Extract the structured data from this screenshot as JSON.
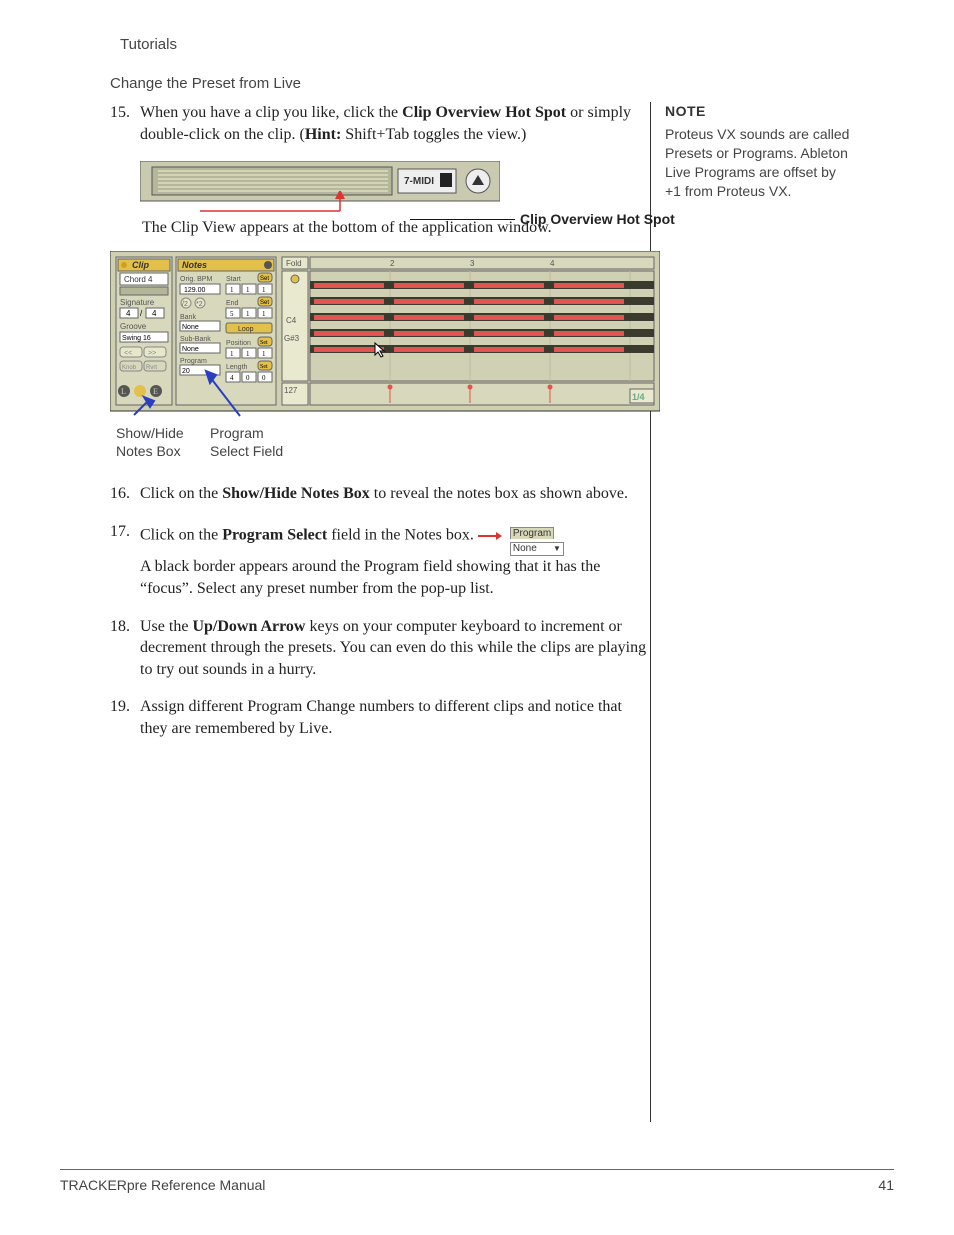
{
  "header": {
    "title": "Tutorials"
  },
  "subheading": "Change the Preset from Live",
  "note": {
    "heading": "NOTE",
    "body": "Proteus VX sounds are called Presets or Programs. Ableton Live Programs are offset by +1 from Proteus VX."
  },
  "steps": [
    {
      "num": "15.",
      "pre": "When you have a clip you like, click the ",
      "bold1": "Clip Overview Hot Spot",
      "mid": " or simply double-click on the clip. (",
      "hintLabel": "Hint:",
      "hintText": " Shift+Tab toggles the view.)"
    },
    {
      "num": "16.",
      "pre": "Click on the ",
      "bold1": "Show/Hide Notes Box",
      "post": " to reveal the notes box as shown above."
    },
    {
      "num": "17.",
      "pre": "Click on the ",
      "bold1": "Program Select",
      "mid": " field in the Notes box.",
      "after": "A black border appears around the Program field showing that it has the “focus”. Select any preset number from the pop-up list."
    },
    {
      "num": "18.",
      "pre": "Use the ",
      "bold1": "Up/Down Arrow",
      "post": " keys on your computer keyboard to increment or decrement through the presets. You can even do this while the clips are playing to try out sounds in a hurry."
    },
    {
      "num": "19.",
      "plain": "Assign different Program Change numbers to different clips and notice that they are remembered by Live."
    }
  ],
  "caption_intro": "The Clip View appears at the bottom of the application window.",
  "fig1": {
    "callout": "Clip Overview Hot Spot",
    "midi_label": "7-MIDI"
  },
  "fig2": {
    "labels": {
      "show_hide_l1": "Show/Hide",
      "show_hide_l2": "Notes Box",
      "program_l1": "Program",
      "program_l2": "Select Field"
    },
    "clip_panel": {
      "title": "Clip",
      "name": "Chord 4",
      "sig_label": "Signature",
      "sig_a": "4",
      "sig_sep": "/",
      "sig_b": "4",
      "groove_label": "Groove",
      "groove_val": "Swing 16",
      "btn_left": "<<",
      "btn_right": ">>",
      "bot_a": "Knob",
      "bot_b": "Rvrt"
    },
    "notes_panel": {
      "title": "Notes",
      "orig_bpm_label": "Orig. BPM",
      "orig_bpm_val": "129.00",
      "bank_label": "Bank",
      "bank_val": "None",
      "subbank_label": "Sub-Bank",
      "subbank_val": "None",
      "program_label": "Program",
      "program_val": "20",
      "div2": "/2",
      "mul2": "*2",
      "start_label": "Start",
      "start_vals": [
        "1",
        "1",
        "1"
      ],
      "end_label": "End",
      "end_vals": [
        "5",
        "1",
        "1"
      ],
      "loop_label": "Loop",
      "pos_label": "Position",
      "pos_vals": [
        "1",
        "1",
        "1"
      ],
      "len_label": "Length",
      "len_vals": [
        "4",
        "0",
        "0"
      ],
      "set": "Set"
    },
    "pianoroll": {
      "fold": "Fold",
      "ruler": [
        "",
        "2",
        "3",
        "4"
      ],
      "keys": [
        "C4",
        "G#3"
      ],
      "vel_label": "127",
      "zoom": "1/4"
    }
  },
  "progbox": {
    "top": "Program",
    "bot": "None"
  },
  "footer": {
    "left": "TRACKERpre Reference Manual",
    "right": "41"
  }
}
